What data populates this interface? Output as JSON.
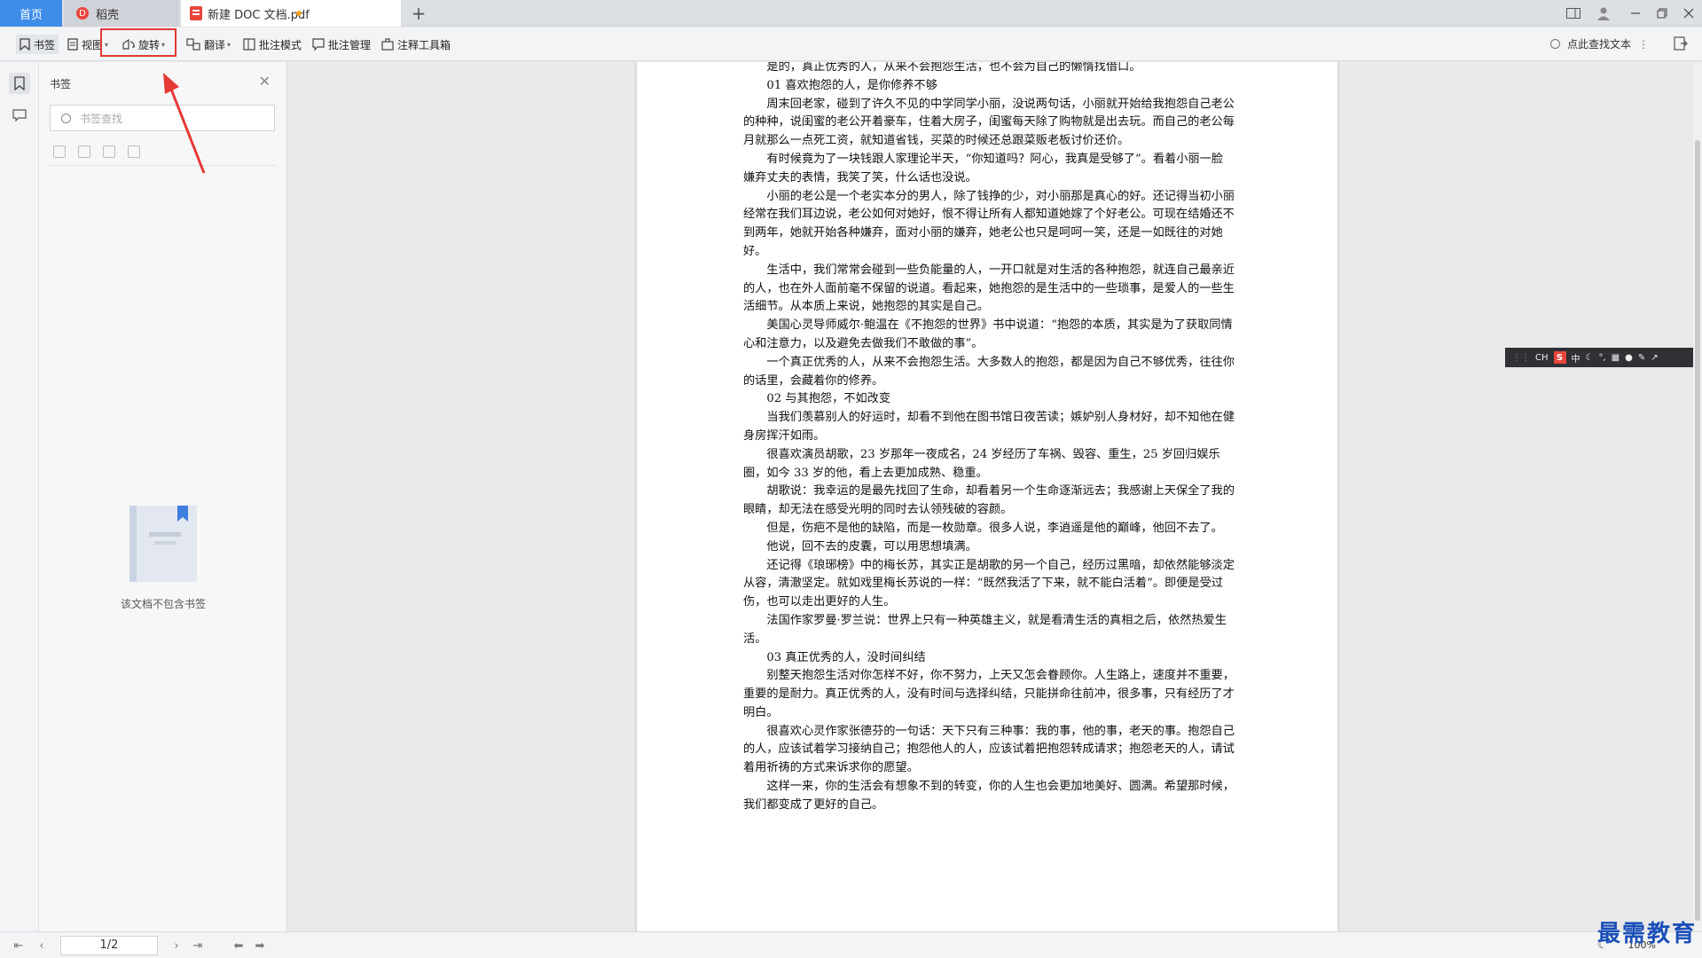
{
  "tabs": {
    "home": "首页",
    "daoke": "稻壳",
    "document": "新建 DOC 文档.pdf",
    "add_symbol": "+"
  },
  "toolbar": {
    "bookmark": "书签",
    "view": "视图",
    "rotate": "旋转",
    "translate": "翻译",
    "annotate_mode": "批注模式",
    "annotate_manage": "批注管理",
    "annotate_tools": "注释工具箱",
    "find_text": "点此查找文本"
  },
  "panel": {
    "title": "书签",
    "search_placeholder": "书签查找",
    "empty_text": "该文档不包含书签"
  },
  "document": {
    "lines": [
      {
        "t": "是的，真正优秀的人，从来不会抱怨生活，也不会为自己的懒惰找借口。",
        "cls": "indent"
      },
      {
        "t": "01  喜欢抱怨的人，是你修养不够",
        "cls": "heading"
      },
      {
        "t": "周末回老家，碰到了许久不见的中学同学小丽，没说两句话，小丽就开始给我抱怨自己老公的种种，说闺蜜的老公开着豪车，住着大房子，闺蜜每天除了购物就是出去玩。而自己的老公每月就那么一点死工资，就知道省钱，买菜的时候还总跟菜贩老板讨价还价。",
        "cls": "indent"
      },
      {
        "t": "有时候竟为了一块钱跟人家理论半天，“你知道吗？阿心，我真是受够了”。看着小丽一脸嫌弃丈夫的表情，我笑了笑，什么话也没说。",
        "cls": "indent"
      },
      {
        "t": "小丽的老公是一个老实本分的男人，除了钱挣的少，对小丽那是真心的好。还记得当初小丽经常在我们耳边说，老公如何对她好，恨不得让所有人都知道她嫁了个好老公。可现在结婚还不到两年，她就开始各种嫌弃，面对小丽的嫌弃，她老公也只是呵呵一笑，还是一如既往的对她好。",
        "cls": "indent"
      },
      {
        "t": "生活中，我们常常会碰到一些负能量的人，一开口就是对生活的各种抱怨，就连自己最亲近的人，也在外人面前毫不保留的说道。看起来，她抱怨的是生活中的一些琐事，是爱人的一些生活细节。从本质上来说，她抱怨的其实是自己。",
        "cls": "indent"
      },
      {
        "t": "美国心灵导师威尔·鲍温在《不抱怨的世界》书中说道：“抱怨的本质，其实是为了获取同情心和注意力，以及避免去做我们不敢做的事”。",
        "cls": "indent"
      },
      {
        "t": "一个真正优秀的人，从来不会抱怨生活。大多数人的抱怨，都是因为自己不够优秀，往往你的话里，会藏着你的修养。",
        "cls": "indent"
      },
      {
        "t": "02  与其抱怨，不如改变",
        "cls": "heading"
      },
      {
        "t": "当我们羡慕别人的好运时，却看不到他在图书馆日夜苦读；嫉妒别人身材好，却不知他在健身房挥汗如雨。",
        "cls": "indent"
      },
      {
        "t": "很喜欢演员胡歌，23 岁那年一夜成名，24 岁经历了车祸、毁容、重生，25 岁回归娱乐圈，如今 33 岁的他，看上去更加成熟、稳重。",
        "cls": "indent"
      },
      {
        "t": "胡歌说：我幸运的是最先找回了生命，却看着另一个生命逐渐远去；我感谢上天保全了我的眼睛，却无法在感受光明的同时去认领残破的容颜。",
        "cls": "indent"
      },
      {
        "t": "但是，伤疤不是他的缺陷，而是一枚勋章。很多人说，李逍遥是他的巅峰，他回不去了。",
        "cls": "indent"
      },
      {
        "t": "他说，回不去的皮囊，可以用思想填满。",
        "cls": "indent"
      },
      {
        "t": "还记得《琅琊榜》中的梅长苏，其实正是胡歌的另一个自己，经历过黑暗，却依然能够淡定从容，清澈坚定。就如戏里梅长苏说的一样：“既然我活了下来，就不能白活着”。即便是受过伤，也可以走出更好的人生。",
        "cls": "indent"
      },
      {
        "t": "法国作家罗曼·罗兰说：世界上只有一种英雄主义，就是看清生活的真相之后，依然热爱生活。",
        "cls": "indent"
      },
      {
        "t": "03  真正优秀的人，没时间纠结",
        "cls": "heading"
      },
      {
        "t": "别整天抱怨生活对你怎样不好，你不努力，上天又怎会眷顾你。人生路上，速度并不重要，重要的是耐力。真正优秀的人，没有时间与选择纠结，只能拼命往前冲，很多事，只有经历了才明白。",
        "cls": "indent"
      },
      {
        "t": "很喜欢心灵作家张德芬的一句话：天下只有三种事：我的事，他的事，老天的事。抱怨自己的人，应该试着学习接纳自己；抱怨他人的人，应该试着把抱怨转成请求；抱怨老天的人，请试着用祈祷的方式来诉求你的愿望。",
        "cls": "indent"
      },
      {
        "t": "这样一来，你的生活会有想象不到的转变，你的人生也会更加地美好、圆满。希望那时候，我们都变成了更好的自己。",
        "cls": "indent"
      }
    ]
  },
  "status": {
    "page": "1/2",
    "zoom": "100%"
  },
  "ime": {
    "lang": "CH",
    "logo": "S",
    "mode": "中"
  },
  "watermark": "最需教育",
  "colors": {
    "home_tab": "#3e8de8",
    "highlight": "#e53935",
    "watermark": "#1b4fb8"
  }
}
